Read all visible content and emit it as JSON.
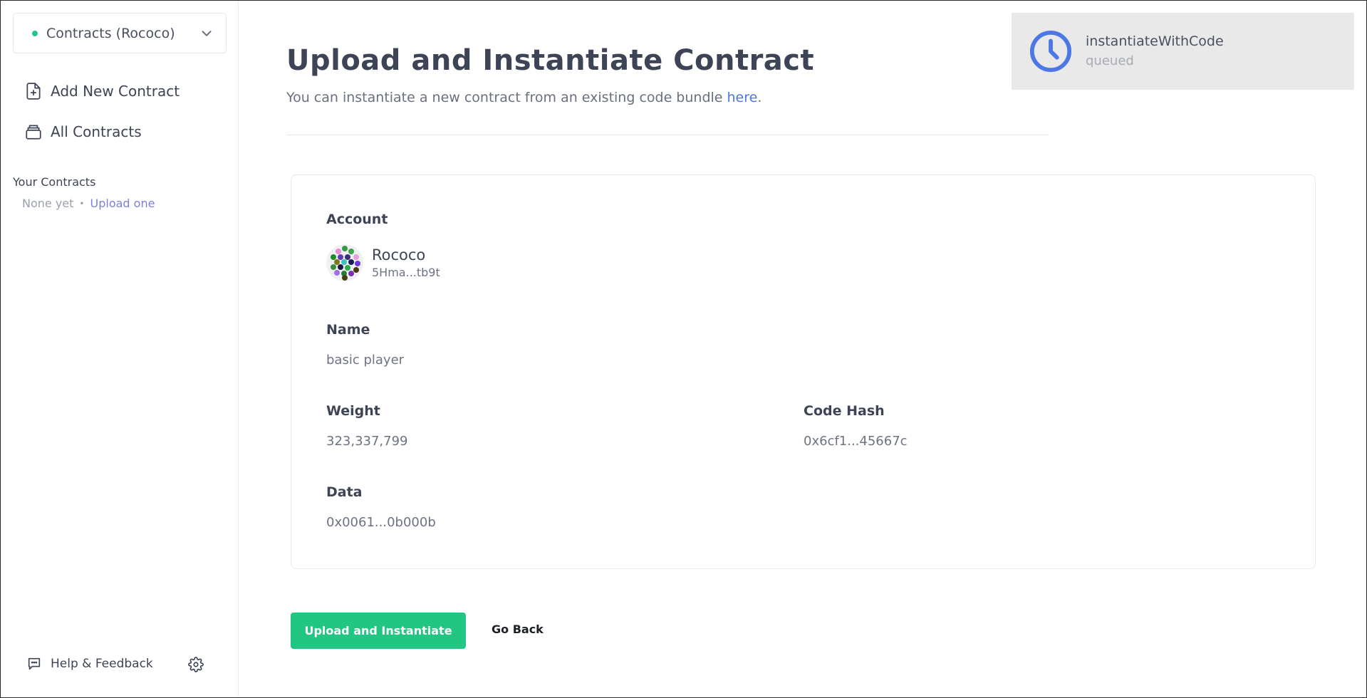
{
  "sidebar": {
    "chain_selector": {
      "label": "Contracts (Rococo)",
      "status_color": "#22c58a"
    },
    "nav": [
      {
        "label": "Add New Contract",
        "icon": "file-plus-icon"
      },
      {
        "label": "All Contracts",
        "icon": "stack-icon"
      }
    ],
    "your_contracts": {
      "title": "Your Contracts",
      "empty_text": "None yet",
      "separator": "•",
      "upload_link": "Upload one"
    },
    "footer": {
      "help_label": "Help & Feedback",
      "help_icon": "chat-icon",
      "settings_icon": "gear-icon"
    }
  },
  "header": {
    "title": "Upload and Instantiate Contract",
    "description_prefix": "You can instantiate a new contract from an existing code bundle ",
    "description_link": "here",
    "description_suffix": "."
  },
  "card": {
    "account": {
      "label": "Account",
      "name": "Rococo",
      "address": "5Hma...tb9t"
    },
    "name": {
      "label": "Name",
      "value": "basic player"
    },
    "weight": {
      "label": "Weight",
      "value": "323,337,799"
    },
    "code_hash": {
      "label": "Code Hash",
      "value": "0x6cf1...45667c"
    },
    "data": {
      "label": "Data",
      "value": "0x0061...0b000b"
    }
  },
  "actions": {
    "primary": "Upload and Instantiate",
    "secondary": "Go Back"
  },
  "toast": {
    "icon": "clock-icon",
    "title": "instantiateWithCode",
    "status": "queued",
    "accent": "#4e77e6"
  },
  "colors": {
    "accent_green": "#22c683",
    "link_blue": "#4e77e6",
    "link_purple": "#7b7fe0"
  }
}
